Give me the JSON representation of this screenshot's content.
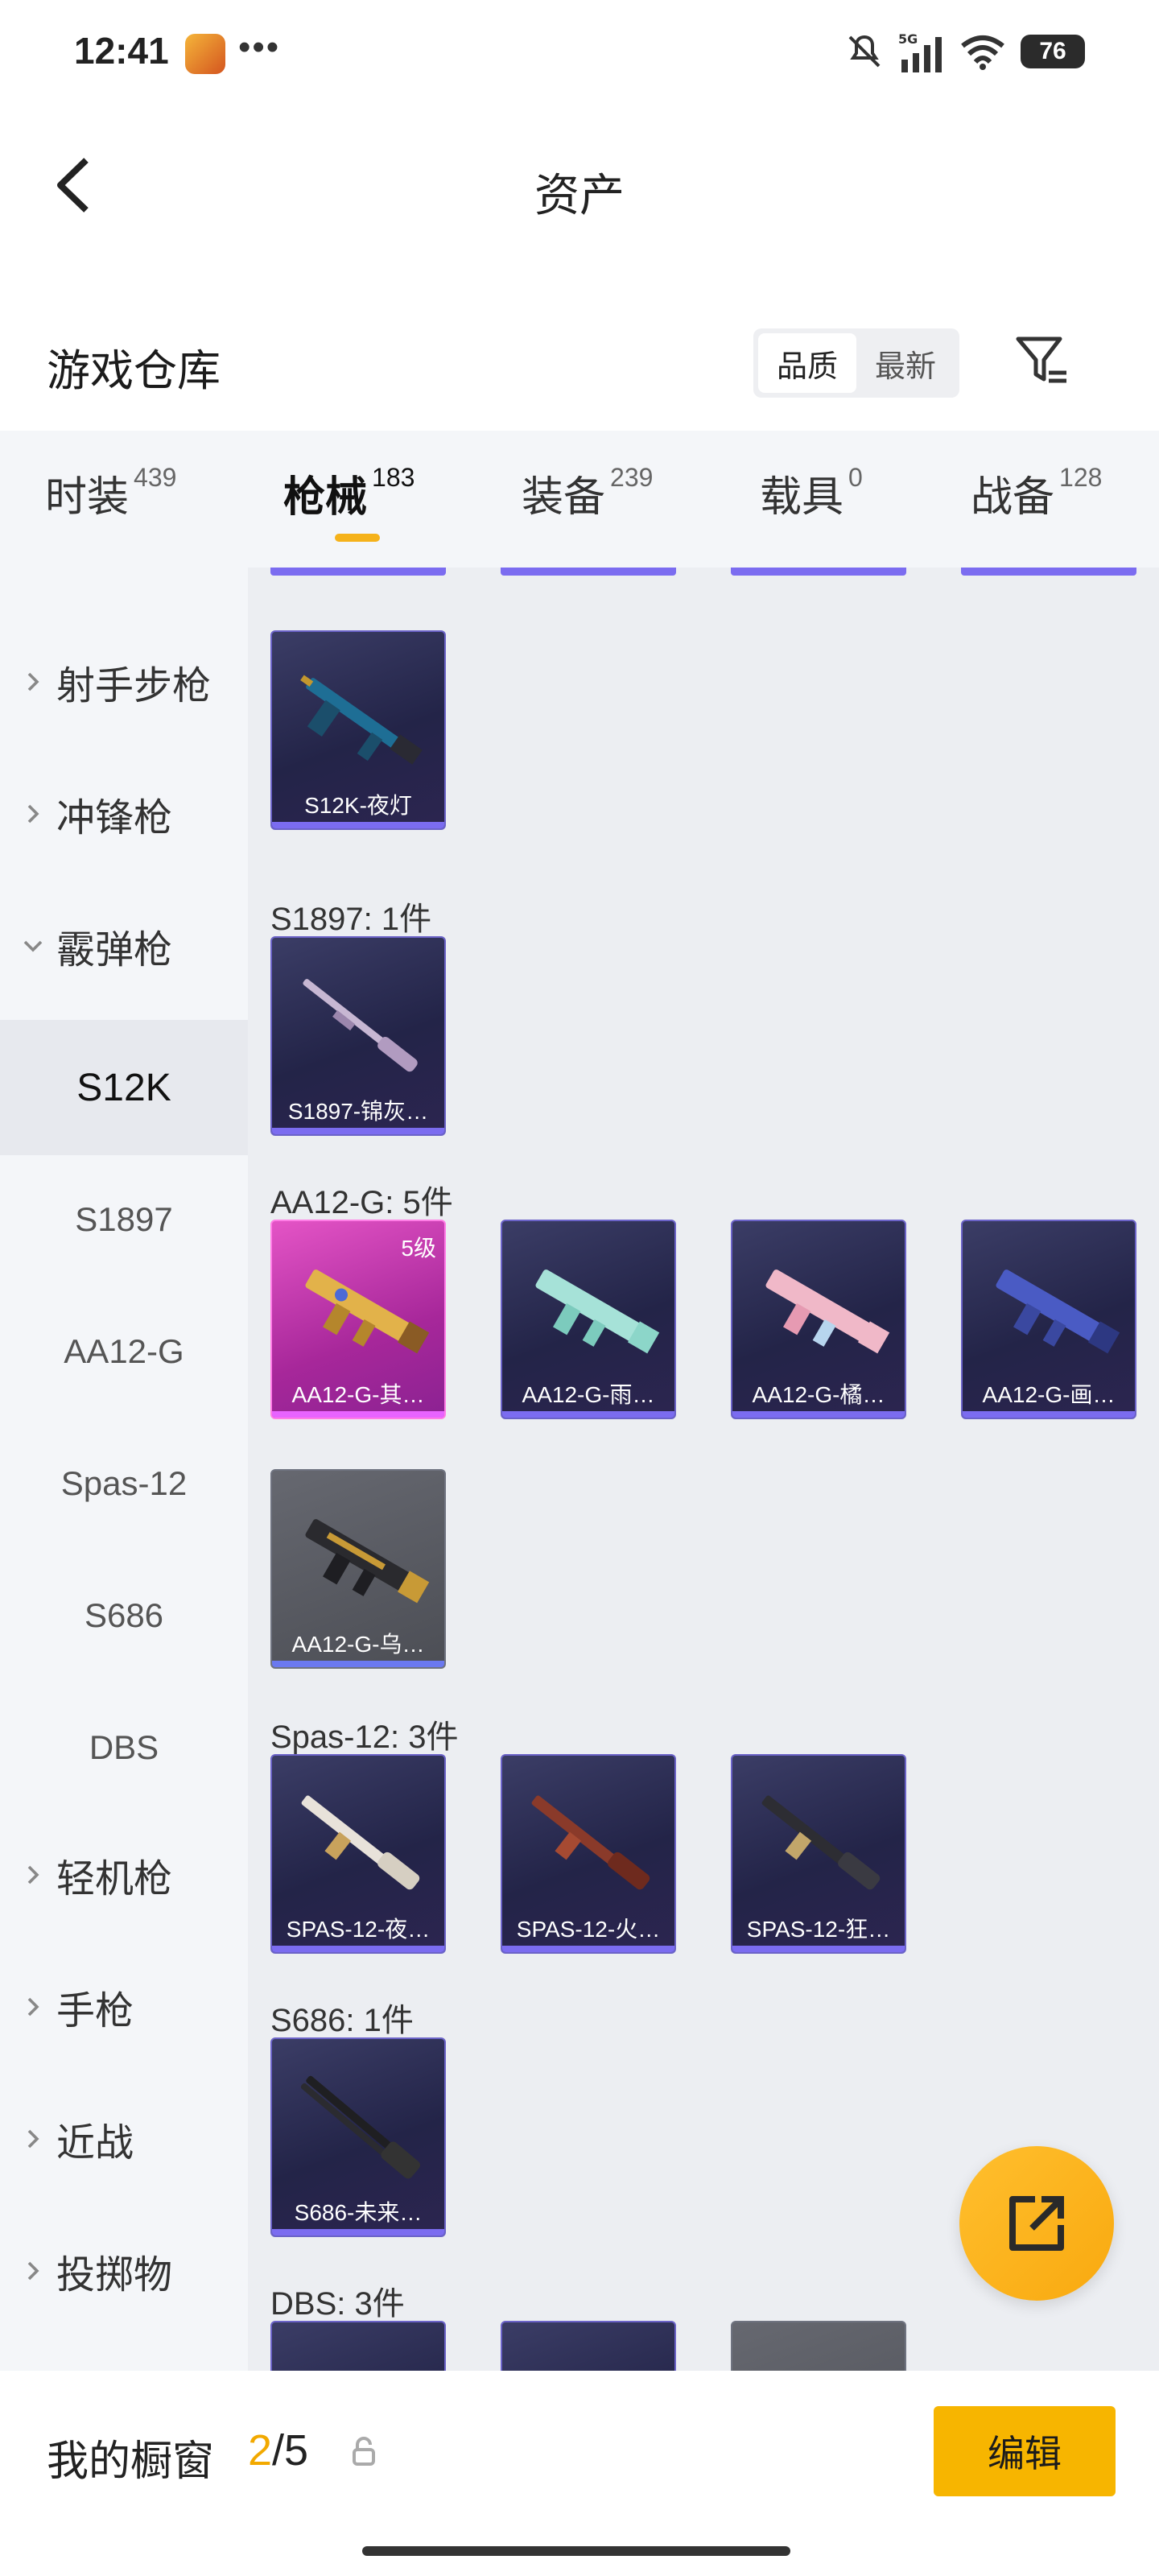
{
  "status_bar": {
    "time": "12:41",
    "dots": "•••",
    "network": "5G",
    "battery": "76"
  },
  "header": {
    "title": "资产"
  },
  "repo": {
    "title": "游戏仓库",
    "sort_options": [
      "品质",
      "最新"
    ],
    "active_sort": "品质"
  },
  "tabs": [
    {
      "label": "时装",
      "count": "439"
    },
    {
      "label": "枪械",
      "count": "183"
    },
    {
      "label": "装备",
      "count": "239"
    },
    {
      "label": "载具",
      "count": "0"
    },
    {
      "label": "战备",
      "count": "128"
    }
  ],
  "active_tab": "枪械",
  "sidebar": {
    "categories": [
      "射手步枪",
      "冲锋枪",
      "霰弹枪",
      "轻机枪",
      "手枪",
      "近战",
      "投掷物"
    ],
    "expanded": "霰弹枪",
    "subitems": [
      "S12K",
      "S1897",
      "AA12-G",
      "Spas-12",
      "S686",
      "DBS"
    ],
    "active_sub": "S12K"
  },
  "groups": [
    {
      "label": "",
      "items": [
        {
          "name": "S12K-夜灯",
          "style": "purple"
        }
      ]
    },
    {
      "label": "S1897: 1件",
      "items": [
        {
          "name": "S1897-锦灰…",
          "style": "purple"
        }
      ]
    },
    {
      "label": "AA12-G: 5件",
      "items": [
        {
          "name": "AA12-G-其…",
          "style": "gold",
          "level": "5级"
        },
        {
          "name": "AA12-G-雨…",
          "style": "purple"
        },
        {
          "name": "AA12-G-橘…",
          "style": "purple"
        },
        {
          "name": "AA12-G-画…",
          "style": "purple"
        },
        {
          "name": "AA12-G-乌…",
          "style": "gray"
        }
      ]
    },
    {
      "label": "Spas-12: 3件",
      "items": [
        {
          "name": "SPAS-12-夜…",
          "style": "purple"
        },
        {
          "name": "SPAS-12-火…",
          "style": "purple"
        },
        {
          "name": "SPAS-12-狂…",
          "style": "purple"
        }
      ]
    },
    {
      "label": "S686: 1件",
      "items": [
        {
          "name": "S686-未来…",
          "style": "purple"
        }
      ]
    },
    {
      "label": "DBS: 3件",
      "items": []
    }
  ],
  "bottom": {
    "window_title": "我的橱窗",
    "current": "2",
    "total": "/5",
    "edit_label": "编辑"
  },
  "colors": {
    "accent": "#f7b500",
    "tab_indicator": "#f5b21b",
    "card_purple": "#7b6cf0",
    "card_gold": "#e454c6"
  }
}
